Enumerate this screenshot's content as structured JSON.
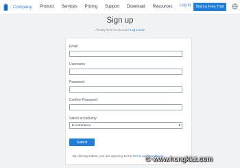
{
  "header": {
    "brand": "Company",
    "nav": [
      "Product",
      "Services",
      "Pricing",
      "Support",
      "Download",
      "Resources"
    ],
    "login": "Log in",
    "cta": "Start a Free Trial",
    "icons": [
      "logo-icon",
      "globe-icon"
    ]
  },
  "signup": {
    "title": "Sign up",
    "subtitle_prefix": "Already have an account?",
    "subtitle_link": "Log in now",
    "fields": [
      {
        "label": "Email",
        "value": ""
      },
      {
        "label": "Username",
        "value": ""
      },
      {
        "label": "Password",
        "value": ""
      },
      {
        "label": "Confirm Password",
        "value": ""
      }
    ],
    "industry": {
      "label": "Select an industry",
      "selected": "E-commerce"
    },
    "submit": "Submit",
    "terms_prefix": "By clicking submit, you are agreeing to the",
    "terms_link": "Terms and Conditions"
  },
  "watermark": "© www.hongkiat.com",
  "colors": {
    "accent": "#1f7ed8",
    "background": "#f1f2f4"
  }
}
